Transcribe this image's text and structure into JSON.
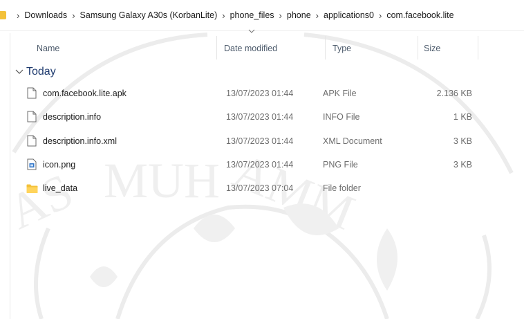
{
  "breadcrumb": {
    "items": [
      "Downloads",
      "Samsung Galaxy A30s (KorbanLite)",
      "phone_files",
      "phone",
      "applications0",
      "com.facebook.lite"
    ]
  },
  "columns": {
    "name": "Name",
    "date": "Date modified",
    "type": "Type",
    "size": "Size"
  },
  "group": {
    "label": "Today"
  },
  "files": [
    {
      "name": "com.facebook.lite.apk",
      "date": "13/07/2023 01:44",
      "type": "APK File",
      "size": "2.136 KB",
      "icon": "document-icon"
    },
    {
      "name": "description.info",
      "date": "13/07/2023 01:44",
      "type": "INFO File",
      "size": "1 KB",
      "icon": "document-icon"
    },
    {
      "name": "description.info.xml",
      "date": "13/07/2023 01:44",
      "type": "XML Document",
      "size": "3 KB",
      "icon": "document-icon"
    },
    {
      "name": "icon.png",
      "date": "13/07/2023 01:44",
      "type": "PNG File",
      "size": "3 KB",
      "icon": "image-file-icon"
    },
    {
      "name": "live_data",
      "date": "13/07/2023 07:04",
      "type": "File folder",
      "size": "",
      "icon": "folder-icon"
    }
  ],
  "colors": {
    "folder": "#f3c13a",
    "group_label": "#1e3a6e",
    "header_text": "#4c5a6b",
    "secondary_text": "#6d6d6d"
  }
}
